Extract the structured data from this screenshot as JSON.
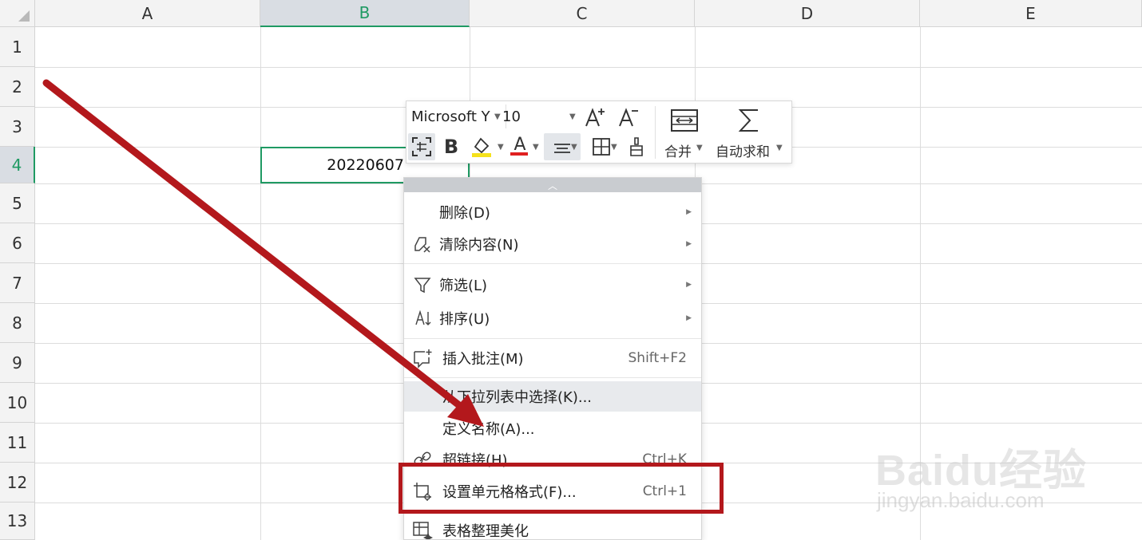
{
  "sheet": {
    "columns": [
      "A",
      "B",
      "C",
      "D",
      "E"
    ],
    "rows": [
      "1",
      "2",
      "3",
      "4",
      "5",
      "6",
      "7",
      "8",
      "9",
      "10",
      "11",
      "12",
      "13"
    ],
    "selected_column": "B",
    "selected_row": "4",
    "active_cell_value": "20220607"
  },
  "mini_toolbar": {
    "font_name": "Microsoft Y",
    "font_size": "10",
    "merge_label": "合并",
    "autosum_label": "自动求和",
    "bold_glyph": "B",
    "font_color_glyph": "A",
    "highlight_color": "#f5e21b",
    "font_color": "#e02020"
  },
  "context_menu": {
    "items": [
      {
        "label": "删除(D)",
        "shortcut": "",
        "icon": "none",
        "has_submenu": true
      },
      {
        "label": "清除内容(N)",
        "shortcut": "",
        "icon": "eraser-icon",
        "has_submenu": true
      },
      {
        "label": "筛选(L)",
        "shortcut": "",
        "icon": "filter-icon",
        "has_submenu": true
      },
      {
        "label": "排序(U)",
        "shortcut": "",
        "icon": "sort-icon",
        "has_submenu": true
      },
      {
        "label": "插入批注(M)",
        "shortcut": "Shift+F2",
        "icon": "comment-icon",
        "has_submenu": false
      },
      {
        "label": "从下拉列表中选择(K)...",
        "shortcut": "",
        "icon": "none",
        "has_submenu": false
      },
      {
        "label": "定义名称(A)...",
        "shortcut": "",
        "icon": "none",
        "has_submenu": false
      },
      {
        "label": "超链接(H)...",
        "shortcut": "Ctrl+K",
        "icon": "link-icon",
        "has_submenu": false
      },
      {
        "label": "设置单元格格式(F)...",
        "shortcut": "Ctrl+1",
        "icon": "cell-format-icon",
        "has_submenu": false
      },
      {
        "label": "表格整理美化",
        "shortcut": "",
        "icon": "table-beautify-icon",
        "has_submenu": false
      }
    ]
  },
  "watermark": {
    "logo_text": "Baidu经验",
    "url_text": "jingyan.baidu.com"
  },
  "annotation": {
    "arrow_color": "#b3181c",
    "box_color": "#b3181c"
  }
}
